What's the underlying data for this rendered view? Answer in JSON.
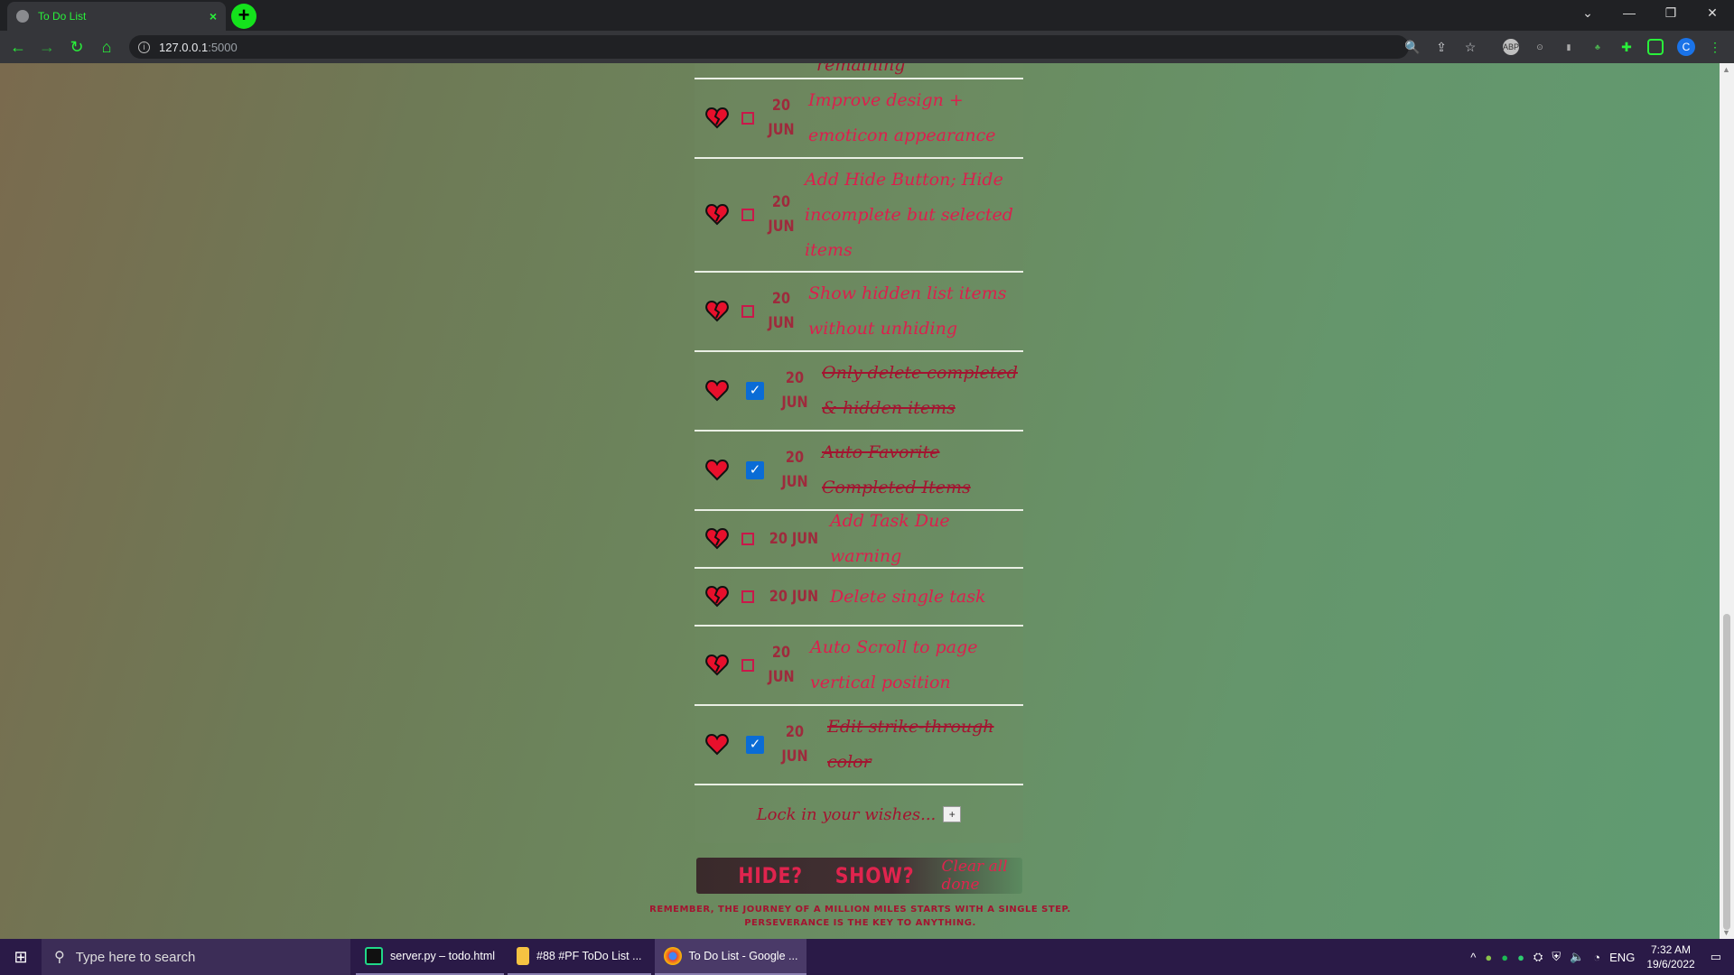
{
  "browser": {
    "tab_title": "To Do List",
    "tab_close": "×",
    "new_tab": "+",
    "url_host": "127.0.0.1",
    "url_port": ":5000",
    "profile_initial": "C",
    "ext_abp": "ABP"
  },
  "todos": [
    {
      "date": "",
      "task": "remaining",
      "done": false,
      "partial": true
    },
    {
      "date_day": "20",
      "date_month": "JUN",
      "task": "Improve design + emoticon appearance",
      "done": false
    },
    {
      "date_day": "20",
      "date_month": "JUN",
      "task": "Add Hide Button; Hide incomplete but selected items",
      "done": false
    },
    {
      "date_day": "20",
      "date_month": "JUN",
      "task": "Show hidden list items without unhiding",
      "done": false
    },
    {
      "date_day": "20",
      "date_month": "JUN",
      "task": "Only delete completed & hidden items",
      "done": true
    },
    {
      "date_day": "20",
      "date_month": "JUN",
      "task": "Auto Favorite Completed Items",
      "done": true
    },
    {
      "date_single": "20 JUN",
      "task": "Add Task Due warning",
      "done": false
    },
    {
      "date_single": "20 JUN",
      "task": "Delete single task",
      "done": false
    },
    {
      "date_day": "20",
      "date_month": "JUN",
      "task": "Auto Scroll to page vertical position",
      "done": false
    },
    {
      "date_day": "20",
      "date_month": "JUN",
      "task": "Edit strike-through color",
      "done": true
    }
  ],
  "wish": {
    "placeholder": "Lock in your wishes...",
    "add_label": "+"
  },
  "actions": {
    "hide": "HIDE?",
    "show": "SHOW?",
    "clear": "Clear all done"
  },
  "footnote": {
    "line1": "REMEMBER, THE JOURNEY OF A MILLION MILES STARTS WITH A SINGLE STEP.",
    "line2": "PERSEVERANCE IS THE KEY TO ANYTHING."
  },
  "taskbar": {
    "search_placeholder": "Type here to search",
    "apps": [
      {
        "label": "server.py – todo.html"
      },
      {
        "label": "#88 #PF ToDo List ..."
      },
      {
        "label": "To Do List - Google ..."
      }
    ],
    "lang": "ENG",
    "time": "7:32 AM",
    "date": "19/6/2022"
  },
  "colors": {
    "accent_green": "#14e21c",
    "task_text": "#dc1f4d",
    "done_text": "#a31430",
    "checkbox_checked": "#0a6cd6"
  }
}
